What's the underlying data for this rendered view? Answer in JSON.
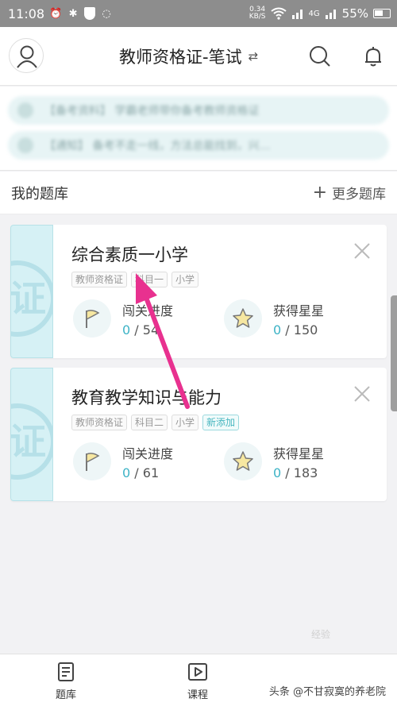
{
  "status_bar": {
    "time": "11:08",
    "net_speed_value": "0.34",
    "net_speed_unit": "KB/S",
    "signal": "4G",
    "battery": "55%"
  },
  "header": {
    "title": "教师资格证-笔试",
    "switch_glyph": "⇄"
  },
  "notices": [
    {
      "text": "【备考资料】 学霸老师带你备考教师资格证"
    },
    {
      "text": "【通知】 备考不走一线，方法总能找到，兴…"
    }
  ],
  "my_bank": {
    "title": "我的题库",
    "more_label": "更多题库"
  },
  "cards": [
    {
      "title": "综合素质一小学",
      "stamp": "证",
      "tags": [
        "教师资格证",
        "科目一",
        "小学"
      ],
      "progress_label": "闯关进度",
      "progress_done": "0",
      "progress_total": "/ 54",
      "stars_label": "获得星星",
      "stars_done": "0",
      "stars_total": "/ 150"
    },
    {
      "title": "教育教学知识与能力",
      "stamp": "证",
      "tags": [
        "教师资格证",
        "科目二",
        "小学"
      ],
      "new_tag": "新添加",
      "progress_label": "闯关进度",
      "progress_done": "0",
      "progress_total": "/ 61",
      "stars_label": "获得星星",
      "stars_done": "0",
      "stars_total": "/ 183"
    }
  ],
  "bottom_nav": {
    "items": [
      {
        "label": "题库",
        "icon": "question-bank-icon"
      },
      {
        "label": "课程",
        "icon": "course-play-icon"
      }
    ]
  },
  "watermark": "头条 @不甘寂寞的养老院",
  "faint_mark": "经验",
  "colors": {
    "accent": "#3db3c6",
    "arrow": "#e8318f",
    "stripe": "#d6f1f5"
  }
}
